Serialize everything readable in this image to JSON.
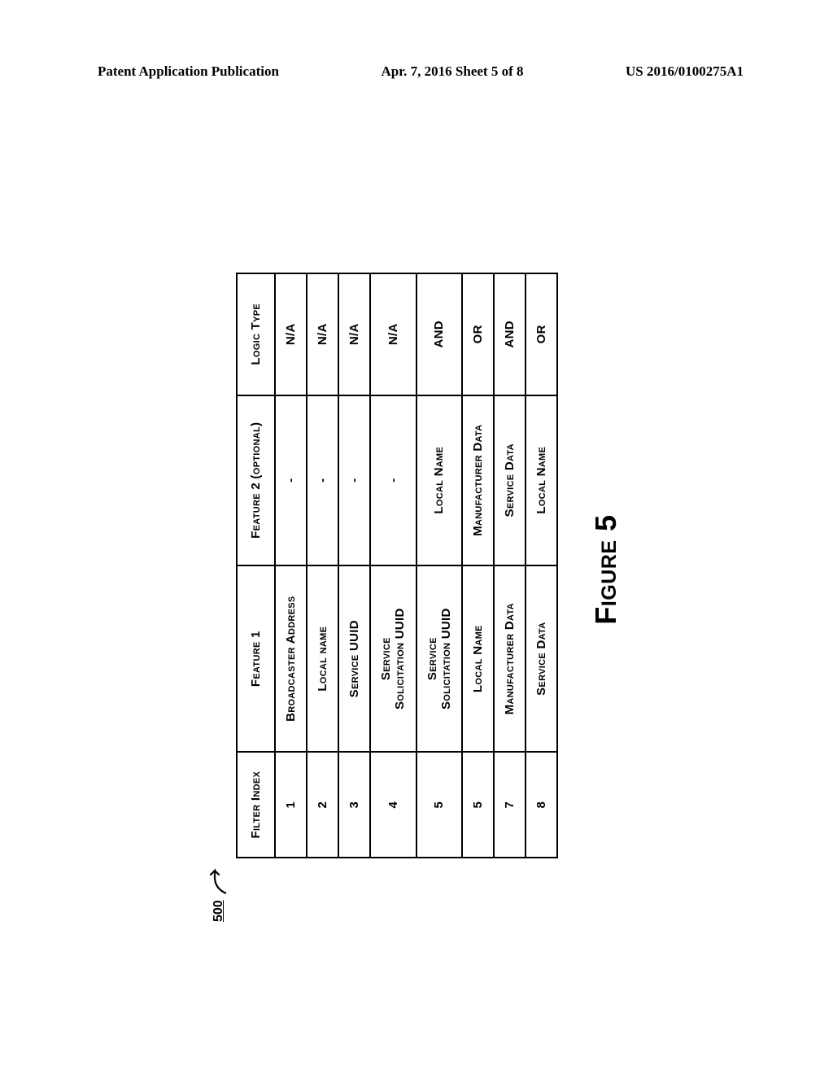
{
  "header": {
    "left": "Patent Application Publication",
    "center": "Apr. 7, 2016  Sheet 5 of 8",
    "right": "US 2016/0100275A1"
  },
  "reference": {
    "number": "500"
  },
  "table": {
    "columns": {
      "filter_index": "Filter Index",
      "feature1": "Feature 1",
      "feature2": "Feature 2 (optional)",
      "logic_type": "Logic Type"
    },
    "rows": [
      {
        "index": "1",
        "feature1": "Broadcaster Address",
        "feature2": "-",
        "logic": "N/A"
      },
      {
        "index": "2",
        "feature1": "Local name",
        "feature2": "-",
        "logic": "N/A"
      },
      {
        "index": "3",
        "feature1": "Service UUID",
        "feature2": "-",
        "logic": "N/A"
      },
      {
        "index": "4",
        "feature1_line1": "Service",
        "feature1_line2": "Solicitation UUID",
        "feature2": "-",
        "logic": "N/A"
      },
      {
        "index": "5",
        "feature1_line1": "Service",
        "feature1_line2": "Solicitation UUID",
        "feature2": "Local Name",
        "logic": "AND"
      },
      {
        "index": "5",
        "feature1": "Local Name",
        "feature2": "Manufacturer Data",
        "logic": "OR"
      },
      {
        "index": "7",
        "feature1": "Manufacturer Data",
        "feature2": "Service Data",
        "logic": "AND"
      },
      {
        "index": "8",
        "feature1": "Service Data",
        "feature2": "Local Name",
        "logic": "OR"
      }
    ]
  },
  "caption": "Figure 5"
}
